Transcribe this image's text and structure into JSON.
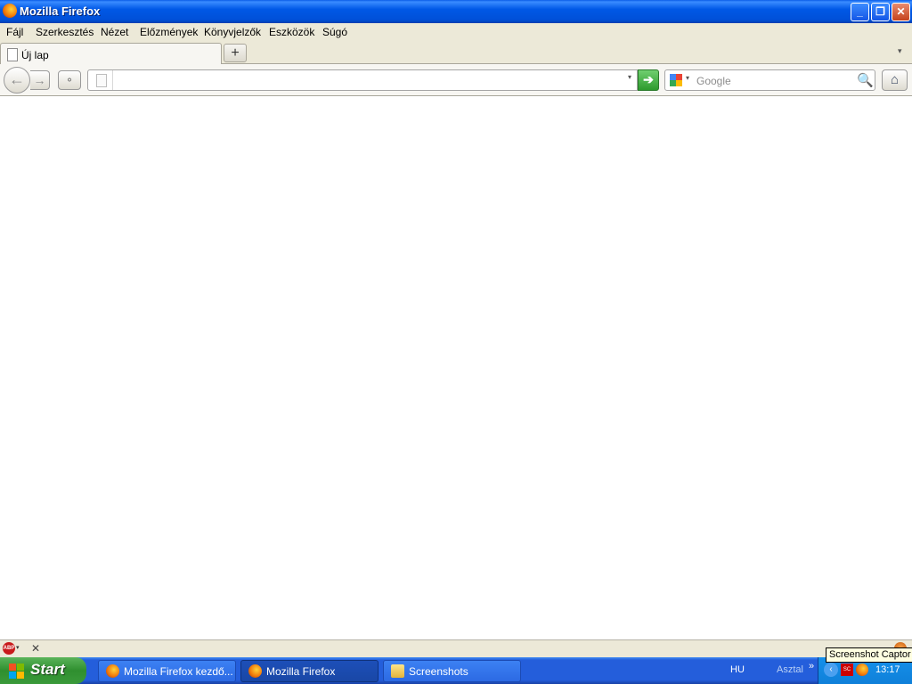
{
  "window": {
    "title": "Mozilla Firefox",
    "controls": {
      "minimize_icon": "minimize-icon",
      "maximize_icon": "restore-icon",
      "close_icon": "close-icon"
    }
  },
  "menu": {
    "items": [
      {
        "label": "Fájl"
      },
      {
        "label": "Szerkesztés"
      },
      {
        "label": "Nézet"
      },
      {
        "label": "Előzmények"
      },
      {
        "label": "Könyvjelzők"
      },
      {
        "label": "Eszközök"
      },
      {
        "label": "Súgó"
      }
    ]
  },
  "tabs": {
    "active_label": "Új lap",
    "new_tab_symbol": "+",
    "list_symbol": "▾"
  },
  "navbar": {
    "back_symbol": "←",
    "forward_symbol": "→",
    "panorama_symbol": "⚬",
    "url_value": "",
    "url_dropmarker": "▾",
    "go_symbol": "➔",
    "search_engine": "google-icon",
    "search_drop": "▾",
    "search_placeholder": "Google",
    "search_go_symbol": "🔍",
    "home_symbol": "⌂"
  },
  "addonbar": {
    "abp_label": "ABP",
    "abp_drop": "▾",
    "close_symbol": "✕"
  },
  "taskbar": {
    "start_label": "Start",
    "tasks": [
      {
        "label": "Mozilla Firefox kezdő...",
        "icon": "firefox-icon"
      },
      {
        "label": "Mozilla Firefox",
        "icon": "firefox-icon"
      },
      {
        "label": "Screenshots",
        "icon": "folder-icon"
      }
    ],
    "language": "HU",
    "desktop_toolbar": "Asztal",
    "chevron": "»",
    "tray_arrow": "‹",
    "tray_sc": "SC",
    "clock": "13:17"
  },
  "tooltip": "Screenshot Captor",
  "colors": {
    "titlebar_blue": "#0058e6",
    "taskbar_blue": "#245edb",
    "start_green": "#2f8f2f",
    "go_green": "#2d9a2d",
    "chrome_beige": "#ece9d8"
  }
}
